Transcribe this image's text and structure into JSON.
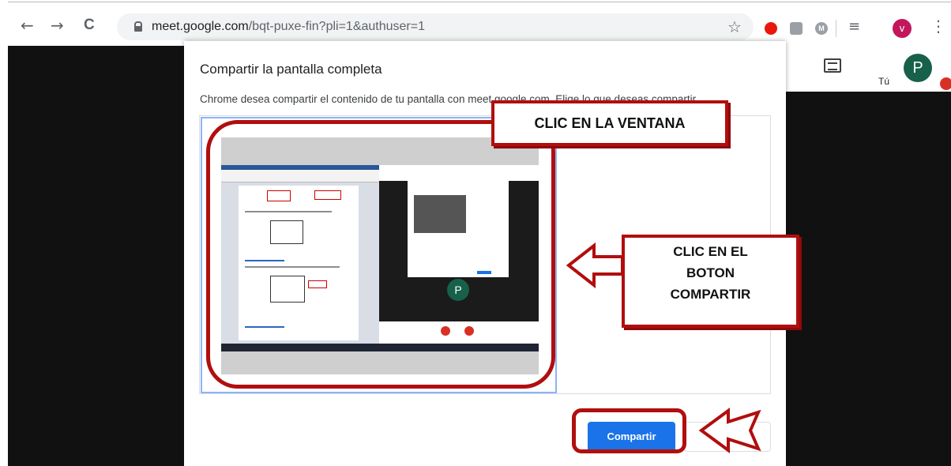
{
  "browser": {
    "back_icon": "←",
    "forward_icon": "→",
    "reload_icon": "C",
    "url_host": "meet.google.com",
    "url_path": "/bqt-puxe-fin?pli=1&authuser=1",
    "star_icon": "☆",
    "ext_m": "M",
    "queue_icon": "≡",
    "profile_initial": "v",
    "menu_icon": "⋮"
  },
  "meet": {
    "user_initial": "P",
    "user_label": "Tú"
  },
  "dialog": {
    "title": "Compartir la pantalla completa",
    "description": "Chrome desea compartir el contenido de tu pantalla con meet.google.com. Elige lo que deseas compartir.",
    "thumbnail_initial": "P",
    "share_button": "Compartir"
  },
  "annotations": {
    "callout_window": "CLIC EN LA VENTANA",
    "callout_button_lines": [
      "CLIC EN EL",
      "BOTON",
      "COMPARTIR"
    ],
    "color": "#b10e0e"
  }
}
